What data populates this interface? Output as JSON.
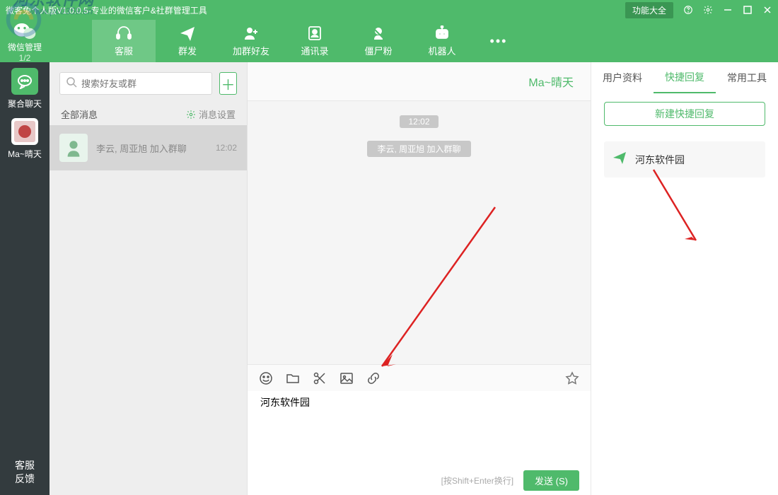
{
  "titlebar": {
    "title": "微客兔个人版V1.0.0.5-专业的微信客户&社群管理工具",
    "feature_btn": "功能大全"
  },
  "header": {
    "wechat_mgmt": "微信管理",
    "count": "1/2",
    "nav": {
      "customer_service": "客服",
      "mass_send": "群发",
      "add_group_friend": "加群好友",
      "contacts": "通讯录",
      "zombie_fans": "僵尸粉",
      "robot": "机器人"
    }
  },
  "left_rail": {
    "item1": "聚合聊天",
    "item2": "Ma~晴天",
    "feedback": "客服\n反馈"
  },
  "contact_list": {
    "search_placeholder": "搜索好友或群",
    "all_msgs": "全部消息",
    "msg_settings": "消息设置",
    "items": [
      {
        "title": "李云, 周亚旭 加入群聊",
        "time": "12:02"
      }
    ]
  },
  "chat": {
    "header_name": "Ma~晴天",
    "time_pill": "12:02",
    "system_msg": "李云, 周亚旭 加入群聊",
    "input_text": "河东软件园",
    "send_hint": "[按Shift+Enter换行]",
    "send_btn": "发送 (S)"
  },
  "right_panel": {
    "tabs": {
      "user_info": "用户资料",
      "quick_reply": "快捷回复",
      "common_tools": "常用工具"
    },
    "new_reply": "新建快捷回复",
    "reply_items": [
      {
        "text": "河东软件园"
      }
    ]
  },
  "icons": {
    "search": "search",
    "plus": "+",
    "gear": "gear",
    "emoji": "emoji",
    "folder": "folder",
    "scissors": "scissors",
    "image": "image",
    "link": "link",
    "star": "star",
    "send_arrow": "send"
  }
}
